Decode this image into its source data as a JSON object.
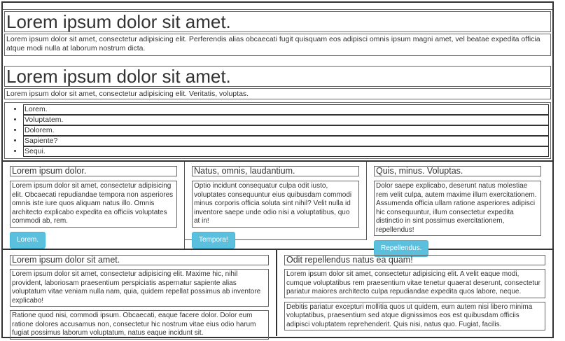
{
  "section1": {
    "heading": "Lorem ipsum dolor sit amet.",
    "paragraph": "Lorem ipsum dolor sit amet, consectetur adipisicing elit. Perferendis alias obcaecati fugit quisquam eos adipisci omnis ipsum magni amet, vel beatae expedita officia atque modi nulla at laborum nostrum dicta."
  },
  "section2": {
    "heading": "Lorem ipsum dolor sit amet.",
    "paragraph": "Lorem ipsum dolor sit amet, consectetur adipisicing elit. Veritatis, voluptas.",
    "list": [
      "Lorem.",
      "Voluptatem.",
      "Dolorem.",
      "Sapiente?",
      "Sequi."
    ]
  },
  "columns": [
    {
      "title": "Lorem ipsum dolor.",
      "text": "Lorem ipsum dolor sit amet, consectetur adipisicing elit. Obcaecati repudiandae tempora non asperiores omnis iste iure quos aliquam natus illo. Omnis architecto explicabo expedita ea officiis voluptates commodi ab, rem.",
      "button": "Lorem."
    },
    {
      "title": "Natus, omnis, laudantium.",
      "text": "Optio incidunt consequatur culpa odit iusto, voluptates consequuntur eius quibusdam commodi minus corporis officia soluta sint nihil? Velit nulla id inventore saepe unde odio nisi a voluptatibus, quo at in!",
      "button": "Tempora!"
    },
    {
      "title": "Quis, minus. Voluptas.",
      "text": "Dolor saepe explicabo, deserunt natus molestiae rem velit culpa, autem maxime illum exercitationem. Assumenda officia ullam ratione asperiores adipisci hic consequuntur, illum consectetur expedita distinctio in sint possimus exercitationem, repellendus!",
      "button": "Repellendus."
    }
  ],
  "bottom": [
    {
      "title": "Lorem ipsum dolor sit amet.",
      "text1": "Lorem ipsum dolor sit amet, consectetur adipisicing elit. Maxime hic, nihil provident, laboriosam praesentium perspiciatis aspernatur sapiente alias voluptatum vitae veniam nulla nam, quia, quidem repellat possimus ab inventore explicabo!",
      "text2": "Ratione quod nisi, commodi ipsum. Obcaecati, eaque facere dolor. Dolor eum ratione dolores accusamus non, consectetur hic nostrum vitae eius odio harum fugiat possimus laborum voluptatum, natus eaque incidunt sit."
    },
    {
      "title": "Odit repellendus natus ea quam!",
      "text1": "Lorem ipsum dolor sit amet, consectetur adipisicing elit. A velit eaque modi, cumque voluptatibus rem praesentium vitae tenetur quaerat deserunt, consectetur pariatur maiores architecto culpa repudiandae expedita quos labore, neque.",
      "text2": "Debitis pariatur excepturi mollitia quos ut quidem, eum autem nisi libero minima voluptatibus, praesentium sed atque dignissimos eos est quibusdam officiis adipisci voluptatem reprehenderit. Quis nisi, natus quo. Fugiat, facilis."
    }
  ],
  "colors": {
    "button_bg": "#5bc0de",
    "button_text": "#ffffff",
    "border": "#333333"
  }
}
